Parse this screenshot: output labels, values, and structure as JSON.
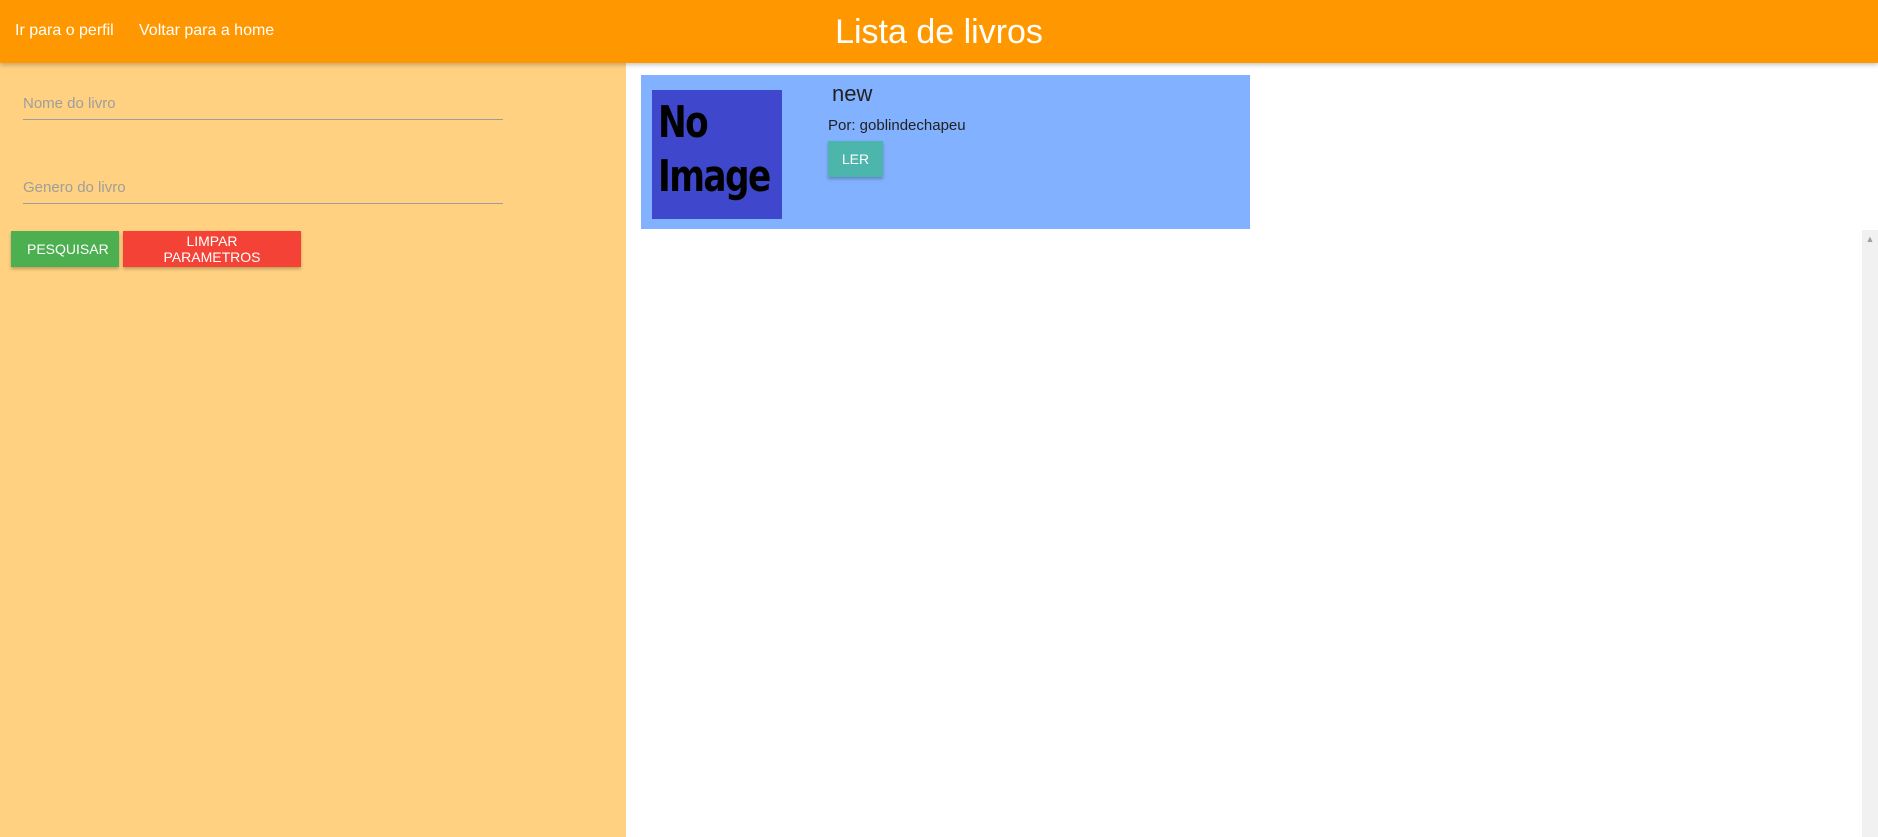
{
  "header": {
    "title": "Lista de livros",
    "links": {
      "profile": "Ir para o perfil",
      "home": "Voltar para a home"
    },
    "color": "#ff9800"
  },
  "sidebar": {
    "color": "#ffd180",
    "fields": {
      "name_placeholder": "Nome do livro",
      "genre_placeholder": "Genero do livro"
    },
    "buttons": {
      "search_label": "PESQUISAR",
      "clear_label": "LIMPAR PARAMETROS"
    }
  },
  "books": [
    {
      "title": "new",
      "author": "Por: goblindechapeu",
      "cover_text": "No Image",
      "read_label": "LER"
    }
  ],
  "colors": {
    "card": "#82b1ff",
    "search_button": "#4caf50",
    "clear_button": "#f44336",
    "read_button": "#4db6ac"
  },
  "icons": {
    "scroll_up": "chevron-up-icon"
  }
}
